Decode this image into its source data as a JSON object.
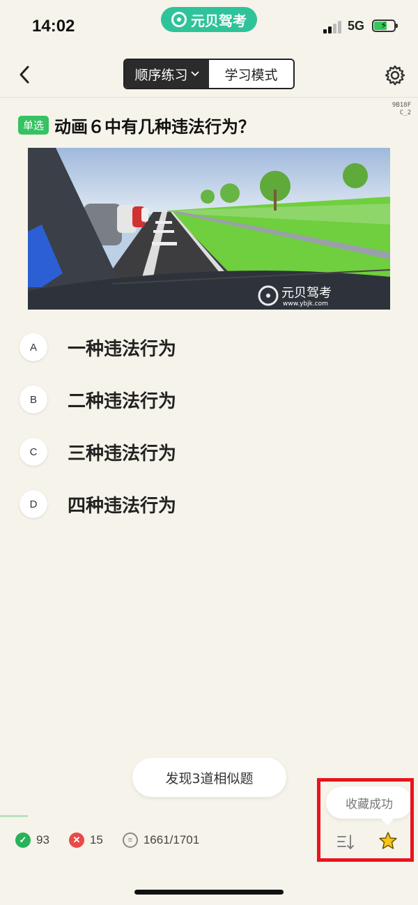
{
  "status": {
    "time": "14:02",
    "app_name": "元贝驾考",
    "network": "5G"
  },
  "nav": {
    "mode_active": "顺序练习",
    "mode_other": "学习模式",
    "icons": [
      "back-icon",
      "chevron-down-icon",
      "gear-icon"
    ]
  },
  "question": {
    "code_line1": "9B18F",
    "code_line2": "C_2",
    "type_tag": "单选",
    "text": "动画６中有几种违法行为？",
    "watermark_name": "元贝驾考",
    "watermark_url": "www.ybjk.com"
  },
  "options": [
    {
      "letter": "A",
      "text": "一种违法行为"
    },
    {
      "letter": "B",
      "text": "二种违法行为"
    },
    {
      "letter": "C",
      "text": "三种违法行为"
    },
    {
      "letter": "D",
      "text": "四种违法行为"
    }
  ],
  "similar_button": "发现3道相似题",
  "toast": "收藏成功",
  "stats": {
    "correct": "93",
    "wrong": "15",
    "progress": "1661/1701"
  },
  "colors": {
    "accent_green": "#2fc39a",
    "tag_green": "#35c262",
    "correct_green": "#27b35a",
    "wrong_red": "#e84a4a",
    "star_yellow": "#f5c518",
    "highlight_red": "#e8141c"
  }
}
